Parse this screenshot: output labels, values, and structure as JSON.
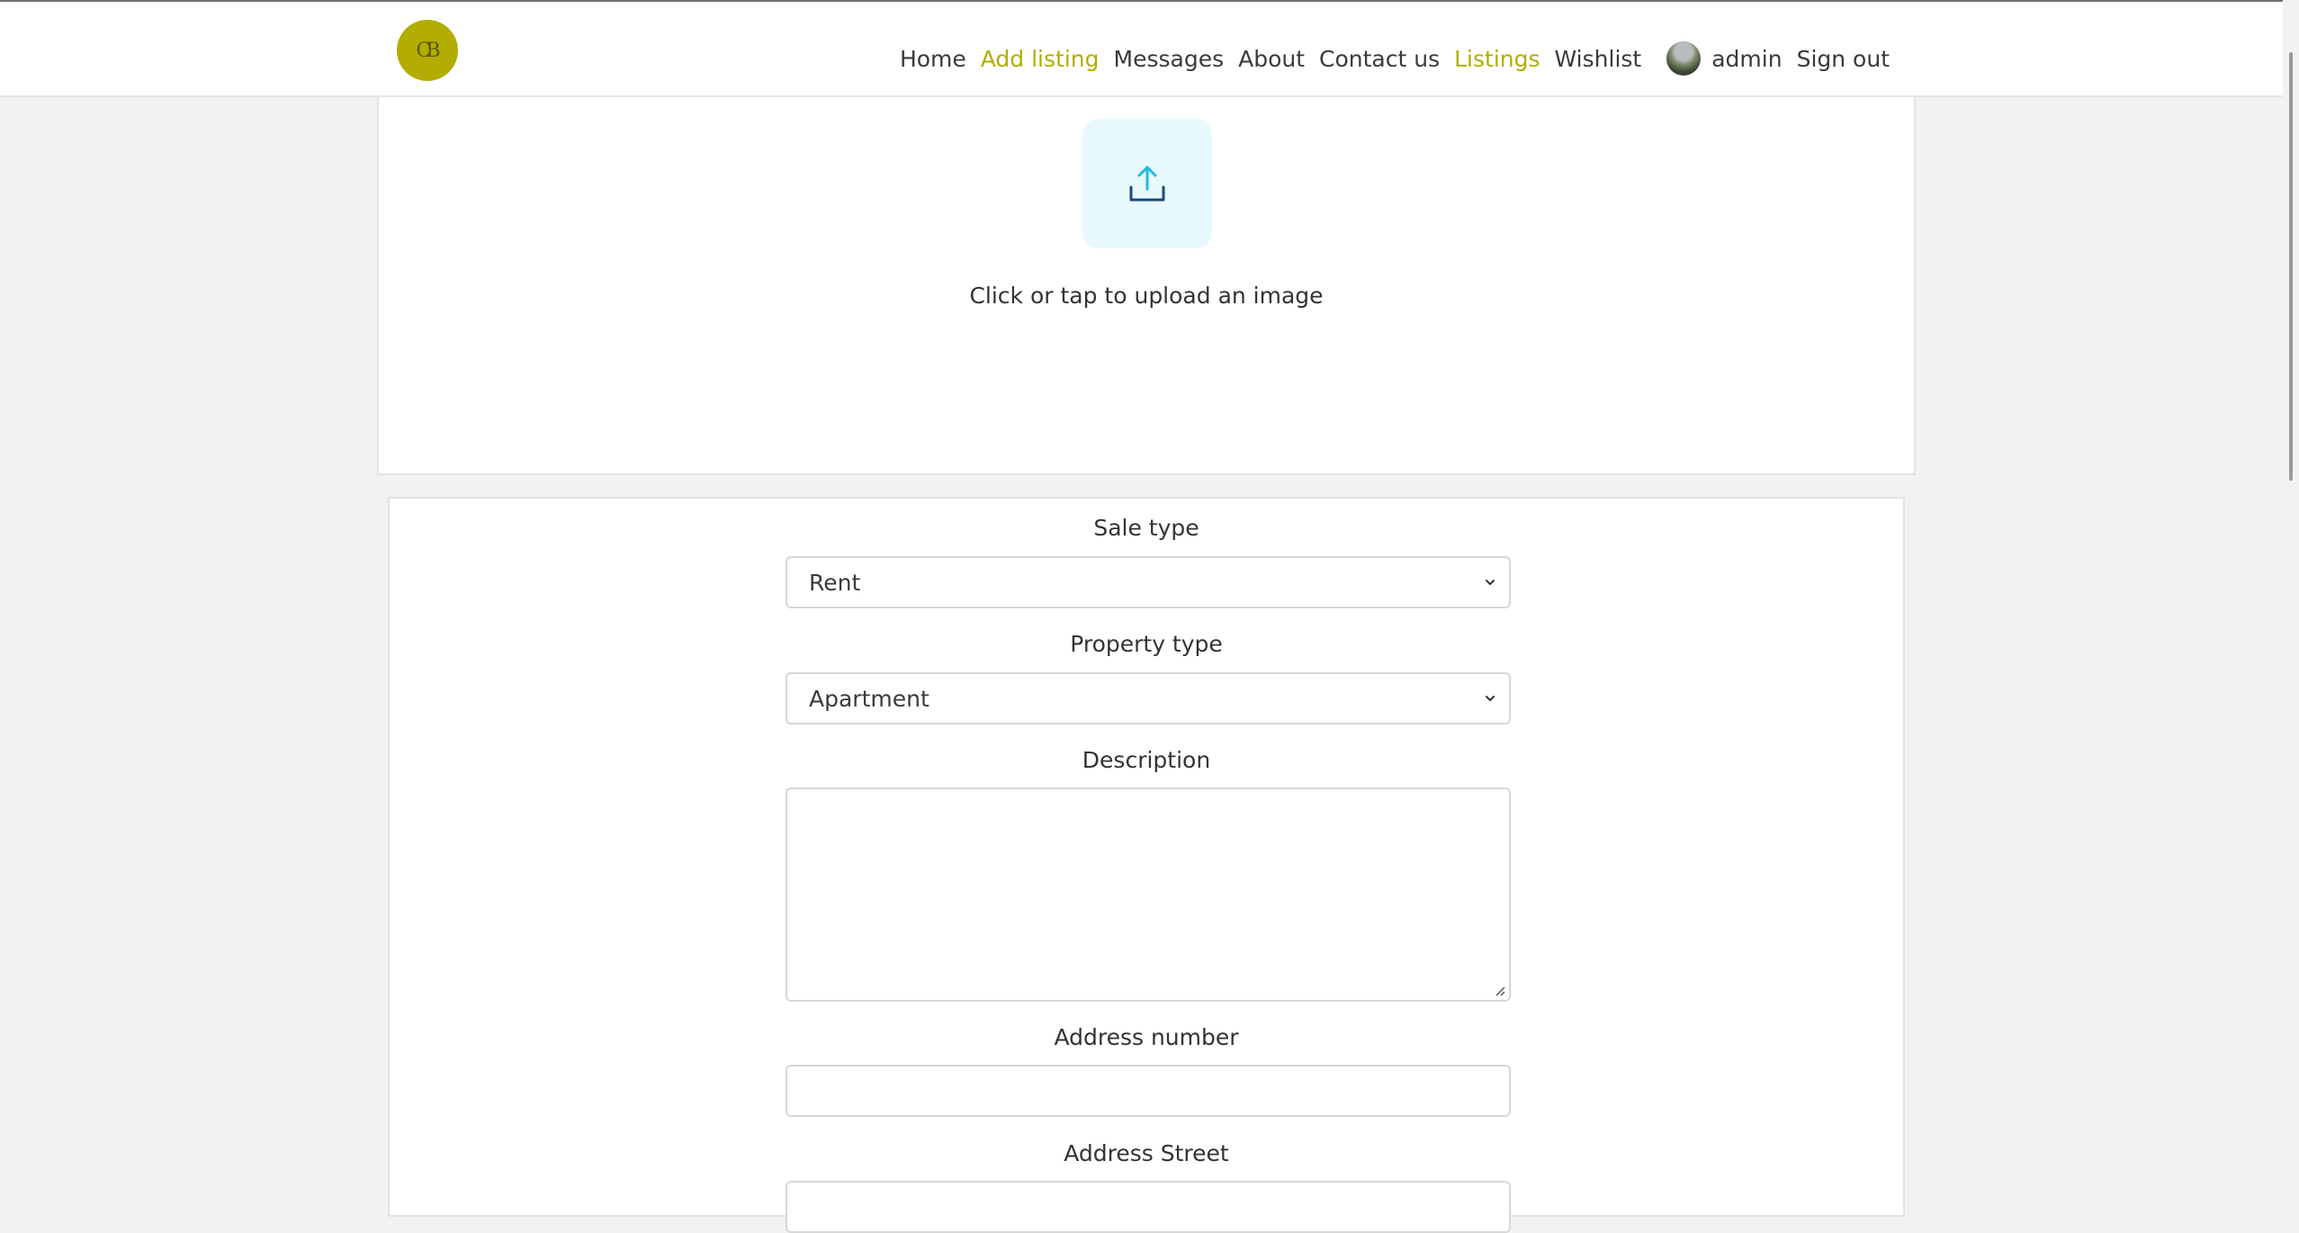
{
  "header": {
    "logo_icon": "cb-monogram-icon",
    "nav": {
      "home": "Home",
      "add_listing": "Add listing",
      "messages": "Messages",
      "about": "About",
      "contact_us": "Contact us",
      "listings": "Listings",
      "wishlist": "Wishlist",
      "user": "admin",
      "sign_out": "Sign out"
    },
    "accent_color": "#b2ad00"
  },
  "upload": {
    "icon": "upload-icon",
    "text": "Click or tap to upload an image"
  },
  "form": {
    "sale_type": {
      "label": "Sale type",
      "value": "Rent"
    },
    "property_type": {
      "label": "Property type",
      "value": "Apartment"
    },
    "description": {
      "label": "Description",
      "value": ""
    },
    "address_number": {
      "label": "Address number",
      "value": ""
    },
    "address_street": {
      "label": "Address Street",
      "value": ""
    }
  }
}
